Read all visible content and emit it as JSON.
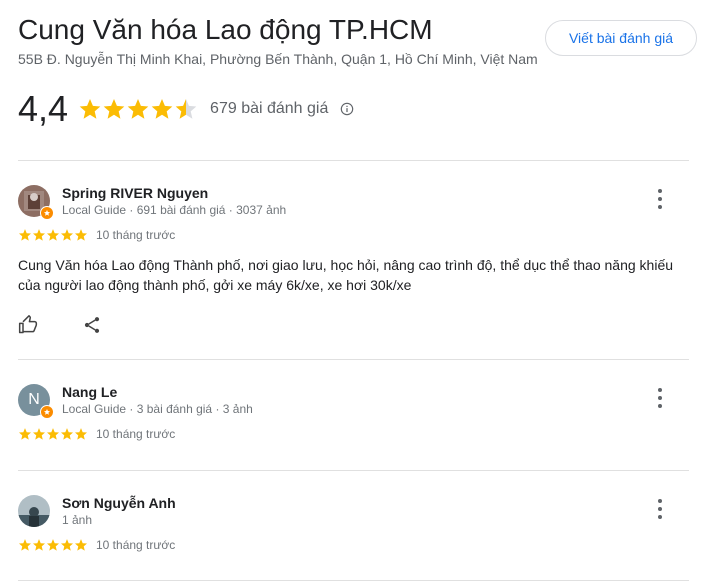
{
  "place": {
    "title": "Cung Văn hóa Lao động TP.HCM",
    "address": "55B Đ. Nguyễn Thị Minh Khai, Phường Bến Thành, Quận 1, Hồ Chí Minh, Việt Nam",
    "rating": "4,4",
    "rating_value": 4.4,
    "review_count": "679 bài đánh giá",
    "write_review_label": "Viết bài đánh giá"
  },
  "colors": {
    "star": "#fbbc04",
    "star_empty": "#dadce0",
    "accent": "#1a73e8",
    "guide_badge": "#fb8c00"
  },
  "reviews": [
    {
      "author": "Spring RIVER Nguyen",
      "meta": "Local Guide · 691 bài đánh giá · 3037 ảnh",
      "stars": 5,
      "time": "10 tháng trước",
      "text": "Cung Văn hóa Lao động Thành phố, nơi giao lưu, học hỏi, nâng cao trình độ, thể dục thể thao năng khiếu của người lao động thành phố, gởi xe máy 6k/xe, xe hơi 30k/xe",
      "avatar": "photo",
      "local_guide": true
    },
    {
      "author": "Nang Le",
      "meta": "Local Guide · 3 bài đánh giá · 3 ảnh",
      "stars": 5,
      "time": "10 tháng trước",
      "avatar_letter": "N",
      "local_guide": true
    },
    {
      "author": "Sơn Nguyễn Anh",
      "meta": "1 ảnh",
      "stars": 5,
      "time": "10 tháng trước",
      "avatar": "photo",
      "local_guide": false
    }
  ],
  "icons": {
    "info": "info-icon",
    "more": "more-vert-icon",
    "like": "thumb-up-icon",
    "share": "share-icon",
    "star": "star-icon"
  }
}
